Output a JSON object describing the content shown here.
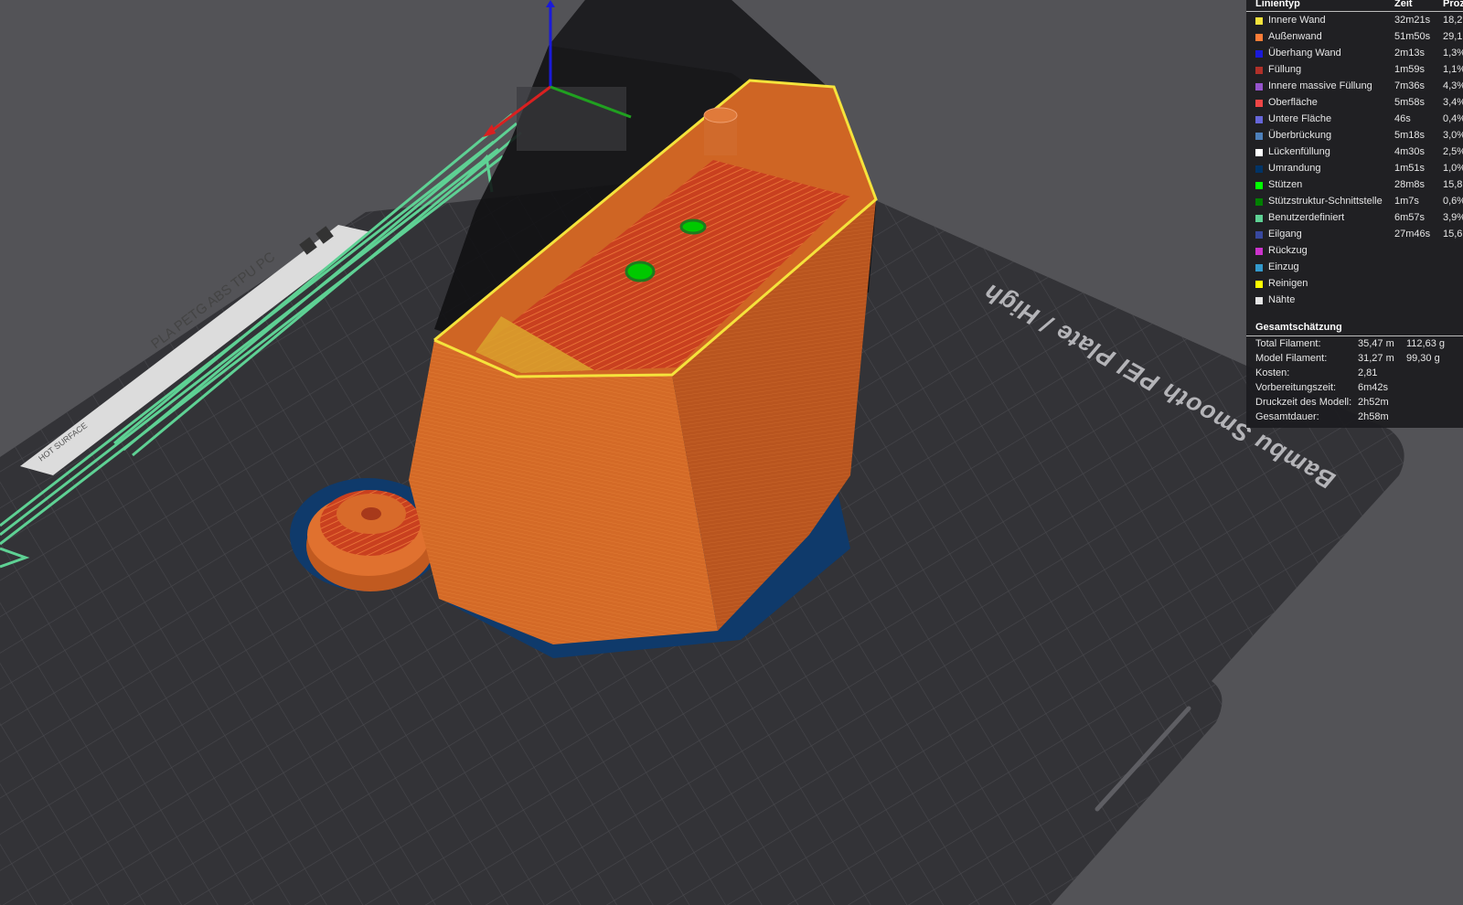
{
  "bed": {
    "label": "Bambu Smooth PEI Plate / High",
    "sticker_text": "PLA PETG ABS TPU PC",
    "hot_surface": "HOT SURFACE"
  },
  "legend": {
    "headers": {
      "type": "Linientyp",
      "time": "Zeit",
      "percent": "Proz"
    },
    "rows": [
      {
        "name": "Innere Wand",
        "time": "32m21s",
        "percent": "18,2",
        "color": "#f5e33c"
      },
      {
        "name": "Außenwand",
        "time": "51m50s",
        "percent": "29,1",
        "color": "#ff7d38"
      },
      {
        "name": "Überhang Wand",
        "time": "2m13s",
        "percent": "1,3%",
        "color": "#1a1ad9"
      },
      {
        "name": "Füllung",
        "time": "1m59s",
        "percent": "1,1%",
        "color": "#b03029"
      },
      {
        "name": "Innere massive Füllung",
        "time": "7m36s",
        "percent": "4,3%",
        "color": "#9654cc"
      },
      {
        "name": "Oberfläche",
        "time": "5m58s",
        "percent": "3,4%",
        "color": "#f04646"
      },
      {
        "name": "Untere Fläche",
        "time": "46s",
        "percent": "0,4%",
        "color": "#6666d9"
      },
      {
        "name": "Überbrückung",
        "time": "5m18s",
        "percent": "3,0%",
        "color": "#4d80ba"
      },
      {
        "name": "Lückenfüllung",
        "time": "4m30s",
        "percent": "2,5%",
        "color": "#ffffff"
      },
      {
        "name": "Umrandung",
        "time": "1m51s",
        "percent": "1,0%",
        "color": "#003366"
      },
      {
        "name": "Stützen",
        "time": "28m8s",
        "percent": "15,8",
        "color": "#00ff00"
      },
      {
        "name": "Stützstruktur-Schnittstelle",
        "time": "1m7s",
        "percent": "0,6%",
        "color": "#008000"
      },
      {
        "name": "Benutzerdefiniert",
        "time": "6m57s",
        "percent": "3,9%",
        "color": "#5ed194"
      },
      {
        "name": "Eilgang",
        "time": "27m46s",
        "percent": "15,6",
        "color": "#38489e"
      },
      {
        "name": "Rückzug",
        "time": "",
        "percent": "",
        "color": "#cc33cc"
      },
      {
        "name": "Einzug",
        "time": "",
        "percent": "",
        "color": "#3399cc"
      },
      {
        "name": "Reinigen",
        "time": "",
        "percent": "",
        "color": "#ffff00"
      },
      {
        "name": "Nähte",
        "time": "",
        "percent": "",
        "color": "#e6e6e6"
      }
    ]
  },
  "summary": {
    "title": "Gesamtschätzung",
    "rows": [
      {
        "label": "Total Filament:",
        "value": "35,47 m",
        "value2": "112,63 g"
      },
      {
        "label": "Model Filament:",
        "value": "31,27 m",
        "value2": "99,30 g"
      },
      {
        "label": "Kosten:",
        "value": "2,81",
        "value2": ""
      },
      {
        "label": "Vorbereitungszeit:",
        "value": "6m42s",
        "value2": ""
      },
      {
        "label": "Druckzeit des Modell:",
        "value": "2h52m",
        "value2": ""
      },
      {
        "label": "Gesamtdauer:",
        "value": "2h58m",
        "value2": ""
      }
    ]
  },
  "colors": {
    "background": "#535357",
    "bed": "#333337",
    "outer_wall": "#ff7d38",
    "inner_wall": "#f5e33c",
    "top_surface": "#f04646",
    "support": "#00ff00",
    "custom": "#5ed194",
    "skirt": "#003366"
  }
}
